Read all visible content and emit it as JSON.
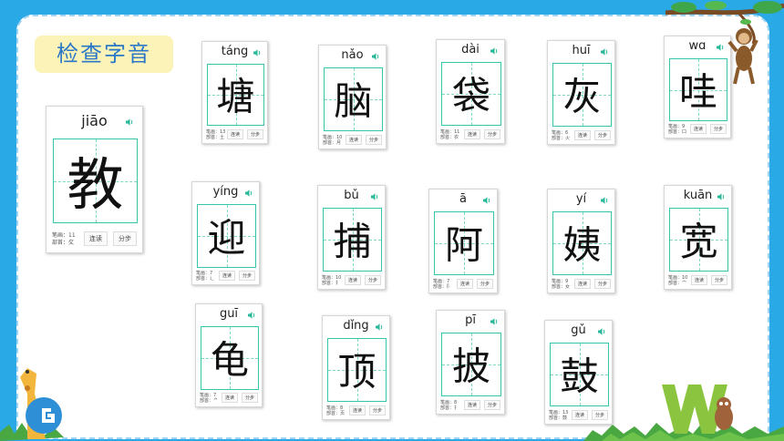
{
  "title": "检查字音",
  "cards": [
    {
      "pinyin": "jiāo",
      "char": "教",
      "strokes": "笔画：11",
      "radical": "部首：攵",
      "btn1": "连读",
      "btn2": "分步"
    },
    {
      "pinyin": "táng",
      "char": "塘",
      "strokes": "笔画：13",
      "radical": "部首：土",
      "btn1": "连读",
      "btn2": "分步"
    },
    {
      "pinyin": "nǎo",
      "char": "脑",
      "strokes": "笔画：10",
      "radical": "部首：月",
      "btn1": "连读",
      "btn2": "分步"
    },
    {
      "pinyin": "dài",
      "char": "袋",
      "strokes": "笔画：11",
      "radical": "部首：衣",
      "btn1": "连读",
      "btn2": "分步"
    },
    {
      "pinyin": "huī",
      "char": "灰",
      "strokes": "笔画：6",
      "radical": "部首：火",
      "btn1": "连读",
      "btn2": "分步"
    },
    {
      "pinyin": "wɑ",
      "char": "哇",
      "strokes": "笔画：9",
      "radical": "部首：口",
      "btn1": "连读",
      "btn2": "分步"
    },
    {
      "pinyin": "yíng",
      "char": "迎",
      "strokes": "笔画：7",
      "radical": "部首：辶",
      "btn1": "连读",
      "btn2": "分步"
    },
    {
      "pinyin": "bǔ",
      "char": "捕",
      "strokes": "笔画：10",
      "radical": "部首：扌",
      "btn1": "连读",
      "btn2": "分步"
    },
    {
      "pinyin": "ā",
      "char": "阿",
      "strokes": "笔画：7",
      "radical": "部首：阝",
      "btn1": "连读",
      "btn2": "分步"
    },
    {
      "pinyin": "yí",
      "char": "姨",
      "strokes": "笔画：9",
      "radical": "部首：女",
      "btn1": "连读",
      "btn2": "分步"
    },
    {
      "pinyin": "kuān",
      "char": "宽",
      "strokes": "笔画：10",
      "radical": "部首：宀",
      "btn1": "连读",
      "btn2": "分步"
    },
    {
      "pinyin": "guī",
      "char": "龟",
      "strokes": "笔画：7",
      "radical": "部首：⺈",
      "btn1": "连读",
      "btn2": "分步"
    },
    {
      "pinyin": "dǐng",
      "char": "顶",
      "strokes": "笔画：8",
      "radical": "部首：页",
      "btn1": "连读",
      "btn2": "分步"
    },
    {
      "pinyin": "pī",
      "char": "披",
      "strokes": "笔画：8",
      "radical": "部首：扌",
      "btn1": "连读",
      "btn2": "分步"
    },
    {
      "pinyin": "gǔ",
      "char": "鼓",
      "strokes": "笔画：13",
      "radical": "部首：鼓",
      "btn1": "连读",
      "btn2": "分步"
    }
  ],
  "colors": {
    "background": "#29a9e6",
    "grid": "#35c5a8",
    "title_bg": "#fbf3b7",
    "title_text": "#2a77c8"
  },
  "icons": [
    "speaker-icon",
    "giraffe-icon",
    "monkey-icon",
    "letter-w-icon",
    "grass-icon"
  ]
}
